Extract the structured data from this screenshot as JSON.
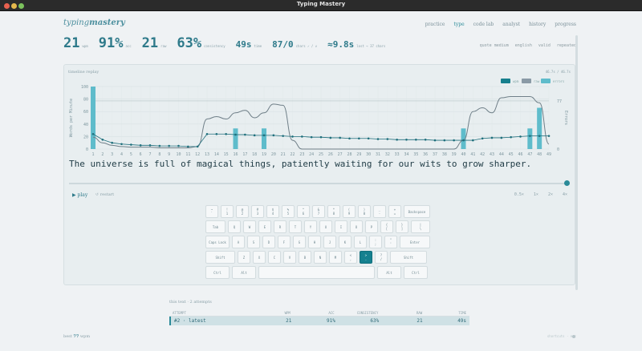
{
  "window": {
    "title": "Typing Mastery"
  },
  "logo": {
    "prefix": "typing",
    "bold": "mastery"
  },
  "nav": [
    {
      "label": "practice",
      "active": false
    },
    {
      "label": "type",
      "active": true
    },
    {
      "label": "code lab",
      "active": false
    },
    {
      "label": "analyst",
      "active": false
    },
    {
      "label": "history",
      "active": false
    },
    {
      "label": "progress",
      "active": false
    }
  ],
  "stats": [
    {
      "value": "21",
      "unit": "wpm"
    },
    {
      "value": "91%",
      "unit": "acc"
    },
    {
      "value": "21",
      "unit": "raw"
    },
    {
      "value": "63%",
      "unit": "consistency"
    },
    {
      "value": "49s",
      "unit": "time"
    },
    {
      "value": "87/0",
      "unit": "chars ✓ / ✗"
    },
    {
      "value": "≈9.8s",
      "unit": "lost → 37 chars"
    }
  ],
  "tags": [
    "quote medium",
    "english",
    "valid",
    "repeated"
  ],
  "panel": {
    "label": "timeline replay",
    "value": "46.7s / 46.7s"
  },
  "legend": {
    "wpm": "wpm",
    "raw": "raw",
    "errors": "errors",
    "accent": "#167f8d",
    "raw_color": "#8a9aa6",
    "err_color": "#5fbccb"
  },
  "chart_data": {
    "type": "line",
    "x": [
      1,
      2,
      3,
      4,
      5,
      6,
      7,
      8,
      9,
      10,
      11,
      12,
      13,
      14,
      15,
      16,
      17,
      18,
      19,
      20,
      21,
      22,
      23,
      24,
      25,
      26,
      27,
      28,
      29,
      30,
      31,
      32,
      33,
      34,
      35,
      36,
      37,
      38,
      39,
      40,
      41,
      42,
      43,
      44,
      45,
      46,
      47,
      48,
      49
    ],
    "ylabel": "Words per Minute",
    "y2label": "Errors",
    "ylim": [
      0,
      100
    ],
    "yticks": [
      0,
      20,
      40,
      60,
      80,
      100
    ],
    "y2ticks": [
      0,
      77
    ],
    "series": [
      {
        "name": "wpm",
        "values": [
          24,
          15,
          10,
          8,
          7,
          6,
          6,
          5,
          5,
          5,
          4,
          4,
          24,
          24,
          24,
          23,
          23,
          22,
          22,
          22,
          21,
          20,
          20,
          19,
          19,
          18,
          18,
          17,
          17,
          17,
          16,
          16,
          15,
          15,
          15,
          15,
          14,
          14,
          14,
          14,
          14,
          17,
          18,
          18,
          19,
          20,
          21,
          21,
          21
        ]
      },
      {
        "name": "raw",
        "values": [
          19,
          10,
          6,
          4,
          3,
          3,
          3,
          2,
          2,
          2,
          2,
          4,
          48,
          52,
          48,
          58,
          62,
          50,
          58,
          72,
          70,
          14,
          0,
          0,
          0,
          0,
          0,
          0,
          0,
          0,
          0,
          0,
          0,
          0,
          0,
          0,
          0,
          0,
          0,
          14,
          60,
          66,
          58,
          82,
          84,
          84,
          84,
          74,
          8
        ]
      },
      {
        "name": "errors",
        "values": [
          1,
          0,
          0,
          0,
          0,
          0,
          0,
          0,
          0,
          0,
          0,
          0,
          0,
          0,
          0,
          1,
          0,
          0,
          1,
          0,
          0,
          0,
          0,
          0,
          0,
          0,
          0,
          0,
          0,
          0,
          0,
          0,
          0,
          0,
          0,
          0,
          0,
          0,
          0,
          1,
          0,
          0,
          0,
          0,
          0,
          0,
          1,
          2,
          0
        ]
      }
    ]
  },
  "sentence": "The universe is full of magical things, patiently waiting for our wits to grow sharper.",
  "controls": {
    "play": "▶ play",
    "restart": "↺ restart",
    "speeds": [
      "0.5×",
      "1×",
      "2×",
      "4×"
    ]
  },
  "keyboard": [
    [
      {
        "t": "~",
        "b": "`",
        "w": 16
      },
      {
        "t": "!",
        "b": "1",
        "w": 16
      },
      {
        "t": "@",
        "b": "2",
        "w": 16
      },
      {
        "t": "#",
        "b": "3",
        "w": 16
      },
      {
        "t": "$",
        "b": "4",
        "w": 16
      },
      {
        "t": "%",
        "b": "5",
        "w": 16
      },
      {
        "t": "^",
        "b": "6",
        "w": 16
      },
      {
        "t": "&",
        "b": "7",
        "w": 16
      },
      {
        "t": "*",
        "b": "8",
        "w": 16
      },
      {
        "t": "(",
        "b": "9",
        "w": 16
      },
      {
        "t": ")",
        "b": "0",
        "w": 16
      },
      {
        "t": "_",
        "b": "-",
        "w": 16
      },
      {
        "t": "+",
        "b": "=",
        "w": 16
      },
      {
        "t": "Backspace",
        "b": "",
        "w": 33
      }
    ],
    [
      {
        "t": "Tab",
        "b": "",
        "w": 25
      },
      {
        "t": "Q",
        "b": "",
        "w": 16
      },
      {
        "t": "W",
        "b": "",
        "w": 16
      },
      {
        "t": "E",
        "b": "",
        "w": 16
      },
      {
        "t": "R",
        "b": "",
        "w": 16
      },
      {
        "t": "T",
        "b": "",
        "w": 16
      },
      {
        "t": "Y",
        "b": "",
        "w": 16
      },
      {
        "t": "U",
        "b": "",
        "w": 16
      },
      {
        "t": "I",
        "b": "",
        "w": 16
      },
      {
        "t": "O",
        "b": "",
        "w": 16
      },
      {
        "t": "P",
        "b": "",
        "w": 16
      },
      {
        "t": "{",
        "b": "[",
        "w": 16
      },
      {
        "t": "}",
        "b": "]",
        "w": 16
      },
      {
        "t": "|",
        "b": "\\",
        "w": 24
      }
    ],
    [
      {
        "t": "Caps Lock",
        "b": "",
        "w": 30
      },
      {
        "t": "A",
        "b": "",
        "w": 16
      },
      {
        "t": "S",
        "b": "",
        "w": 16
      },
      {
        "t": "D",
        "b": "",
        "w": 16
      },
      {
        "t": "F",
        "b": "",
        "w": 16
      },
      {
        "t": "G",
        "b": "",
        "w": 16
      },
      {
        "t": "H",
        "b": "",
        "w": 16
      },
      {
        "t": "J",
        "b": "",
        "w": 16
      },
      {
        "t": "K",
        "b": "",
        "w": 16
      },
      {
        "t": "L",
        "b": "",
        "w": 16
      },
      {
        "t": ":",
        "b": ";",
        "w": 16
      },
      {
        "t": "\"",
        "b": "'",
        "w": 16
      },
      {
        "t": "Enter",
        "b": "",
        "w": 38
      }
    ],
    [
      {
        "t": "Shift",
        "b": "",
        "w": 37
      },
      {
        "t": "Z",
        "b": "",
        "w": 16
      },
      {
        "t": "X",
        "b": "",
        "w": 16
      },
      {
        "t": "C",
        "b": "",
        "w": 16
      },
      {
        "t": "V",
        "b": "",
        "w": 16
      },
      {
        "t": "B",
        "b": "",
        "w": 16
      },
      {
        "t": "N",
        "b": "",
        "w": 16
      },
      {
        "t": "M",
        "b": "",
        "w": 16
      },
      {
        "t": "<",
        "b": ",",
        "w": 16
      },
      {
        "t": ">",
        "b": ".",
        "w": 16,
        "hl": true
      },
      {
        "t": "?",
        "b": "/",
        "w": 16
      },
      {
        "t": "Shift",
        "b": "",
        "w": 46
      }
    ],
    [
      {
        "t": "Ctrl",
        "b": "",
        "w": 30
      },
      {
        "t": "Alt",
        "b": "",
        "w": 30
      },
      {
        "t": "",
        "b": "",
        "w": 145
      },
      {
        "t": "Alt",
        "b": "",
        "w": 30
      },
      {
        "t": "Ctrl",
        "b": "",
        "w": 30
      }
    ]
  ],
  "history": {
    "title": "this text · 2 attempts",
    "headers": [
      "ATTEMPT",
      "WPM",
      "ACC",
      "CONSISTENCY",
      "RAW",
      "TIME"
    ],
    "rows": [
      [
        "#2 · latest",
        "21",
        "91%",
        "63%",
        "21",
        "49s"
      ]
    ]
  },
  "best": {
    "label": "best",
    "value": "77",
    "unit": "wpm"
  },
  "footer_right": "shortcuts · esc"
}
